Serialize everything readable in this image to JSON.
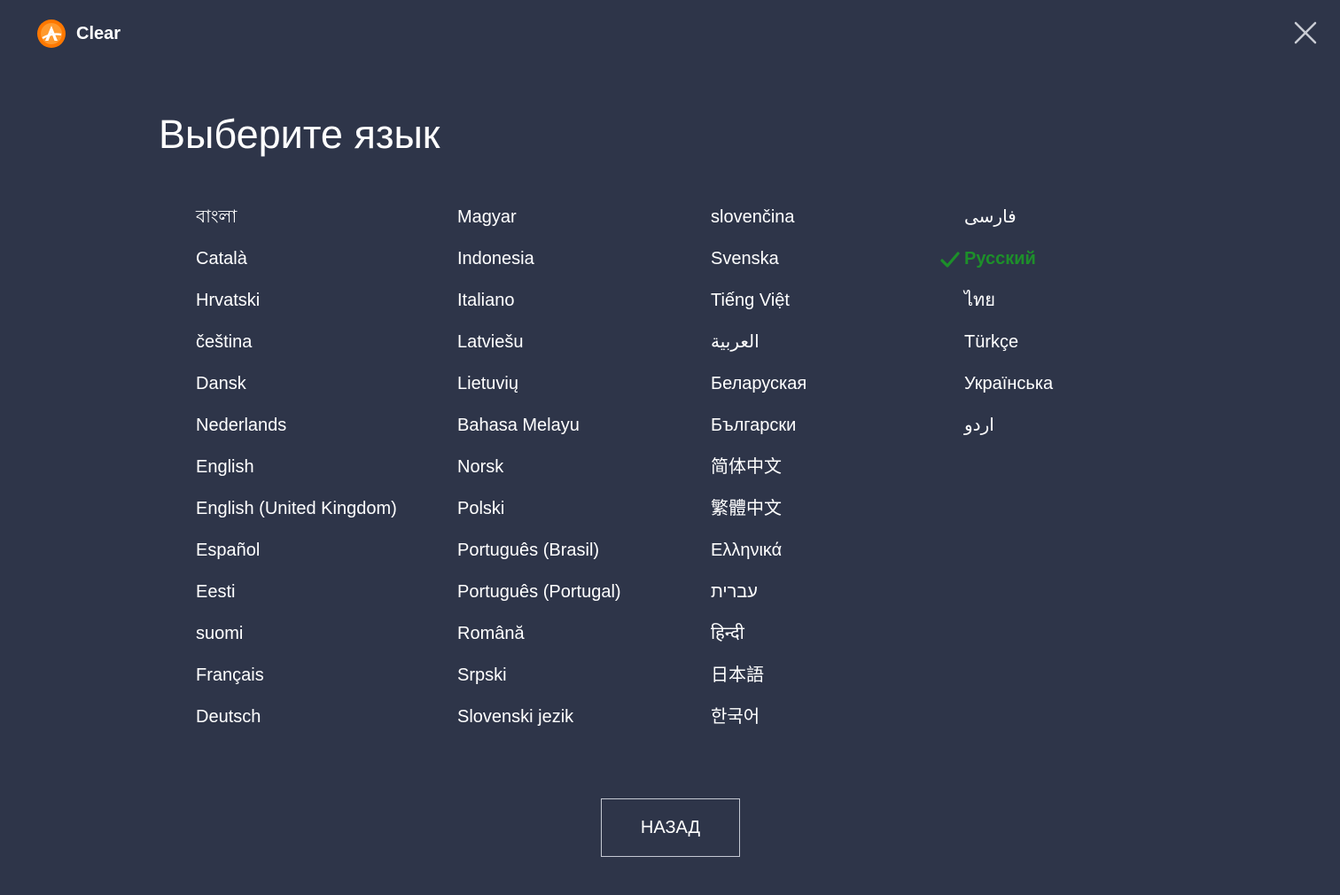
{
  "app": {
    "name": "Clear",
    "logo_icon": "avast-logo-icon",
    "accent_color": "#ff7800"
  },
  "window": {
    "close_icon": "close-icon",
    "background_color": "#2e3549"
  },
  "page": {
    "title": "Выберите язык"
  },
  "languages": {
    "selected": "Русский",
    "selected_color": "#1d8f2a",
    "selected_icon": "checkmark-icon",
    "columns": [
      [
        "বাংলা",
        "Català",
        "Hrvatski",
        "čeština",
        "Dansk",
        "Nederlands",
        "English",
        "English (United Kingdom)",
        "Español",
        "Eesti",
        "suomi",
        "Français",
        "Deutsch"
      ],
      [
        "Magyar",
        "Indonesia",
        "Italiano",
        "Latviešu",
        "Lietuvių",
        "Bahasa Melayu",
        "Norsk",
        "Polski",
        "Português (Brasil)",
        "Português (Portugal)",
        "Română",
        "Srpski",
        "Slovenski jezik"
      ],
      [
        "slovenčina",
        "Svenska",
        "Tiếng Việt",
        "العربية",
        "Беларуская",
        "Български",
        "简体中文",
        "繁體中文",
        "Ελληνικά",
        "עברית",
        "हिन्दी",
        "日本語",
        "한국어"
      ],
      [
        "فارسی",
        "Русский",
        "ไทย",
        "Türkçe",
        "Українська",
        "اردو"
      ]
    ]
  },
  "footer": {
    "back_label": "НАЗАД"
  }
}
